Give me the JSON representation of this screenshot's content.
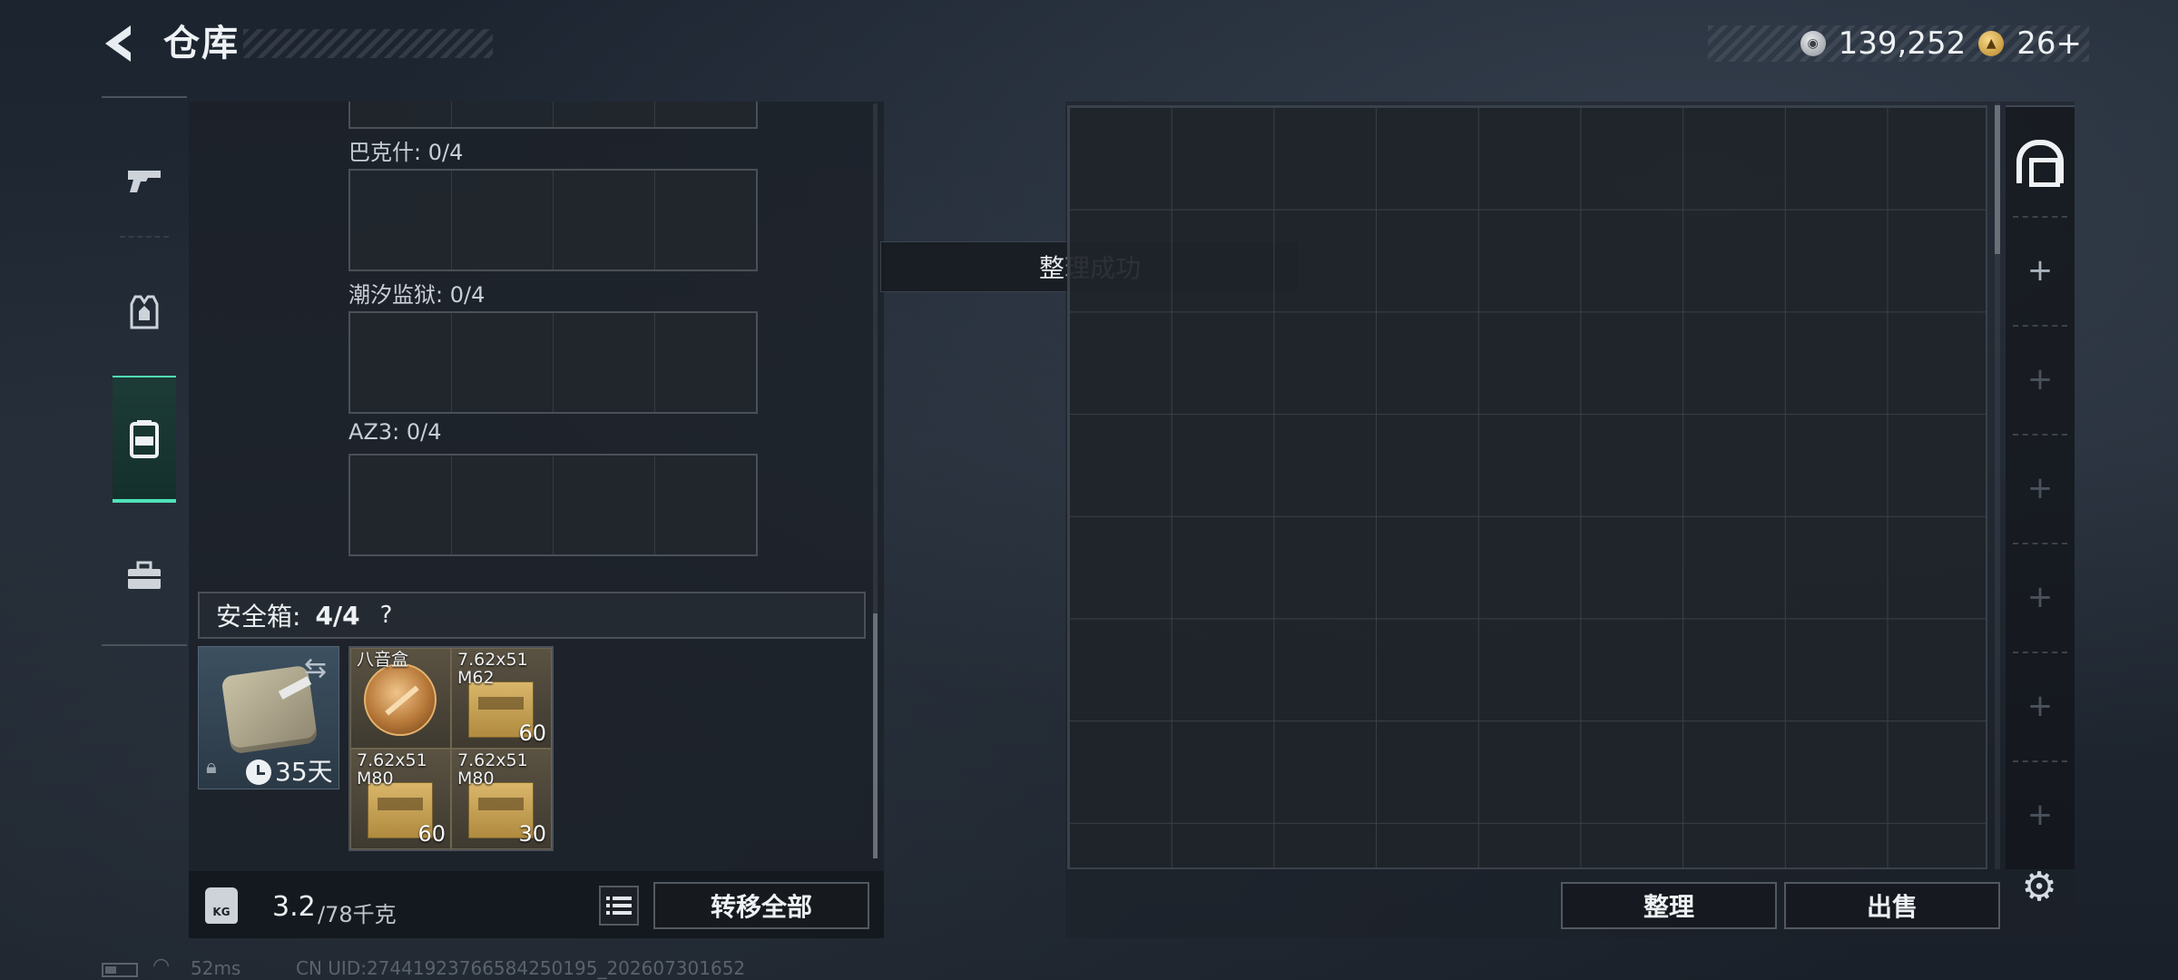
{
  "header": {
    "title": "仓库",
    "currencies": [
      {
        "icon": "silver-coin-icon",
        "value": "139,252"
      },
      {
        "icon": "gold-triangle-coin-icon",
        "value": "26+"
      }
    ]
  },
  "rail": {
    "items": [
      {
        "name": "weapons",
        "icon": "pistol-icon"
      },
      {
        "name": "gear",
        "icon": "vest-icon"
      },
      {
        "name": "containers",
        "icon": "backpack-icon",
        "active": true
      },
      {
        "name": "supplies",
        "icon": "toolbox-icon"
      }
    ]
  },
  "left_panel": {
    "slots": [
      {
        "label": "巴克什: 0/4"
      },
      {
        "label": "潮汐监狱: 0/4"
      },
      {
        "label": "AZ3: 0/4"
      }
    ],
    "safe_box": {
      "label": "安全箱:",
      "count": "4/4",
      "help": "?",
      "case_days": "35天",
      "items": [
        {
          "name": "八音盒",
          "qty": ""
        },
        {
          "name": "7.62x51 M62",
          "qty": "60"
        },
        {
          "name": "7.62x51 M80",
          "qty": "60"
        },
        {
          "name": "7.62x51 M80",
          "qty": "30"
        }
      ]
    },
    "weight": {
      "current": "3.2",
      "max": "/78千克",
      "icon_text": "KG"
    },
    "transfer_all": "转移全部"
  },
  "toast": "整理成功",
  "right_panel": {
    "sort_label": "整理",
    "sell_label": "出售",
    "side_tabs": [
      "+",
      "+",
      "+",
      "+",
      "+",
      "+"
    ]
  },
  "status": {
    "ping": "52ms",
    "uid": "CN UID:27441923766584250195_202607301652"
  }
}
